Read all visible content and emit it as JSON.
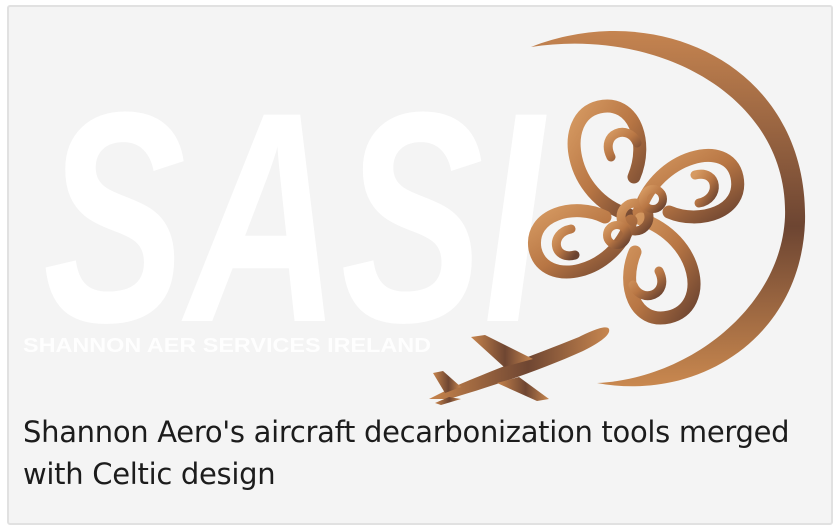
{
  "logo": {
    "wordmark": "SASI",
    "tagline": "SHANNON AER SERVICES IRELAND",
    "colors": {
      "copper_light": "#c9874e",
      "copper_dark": "#6b4330",
      "wordmark": "#ffffff"
    },
    "icons": [
      "celtic-knot-icon",
      "airplane-icon",
      "orbit-arc"
    ]
  },
  "caption": {
    "text": "Shannon Aero's aircraft decarbonization tools merged with Celtic design"
  }
}
